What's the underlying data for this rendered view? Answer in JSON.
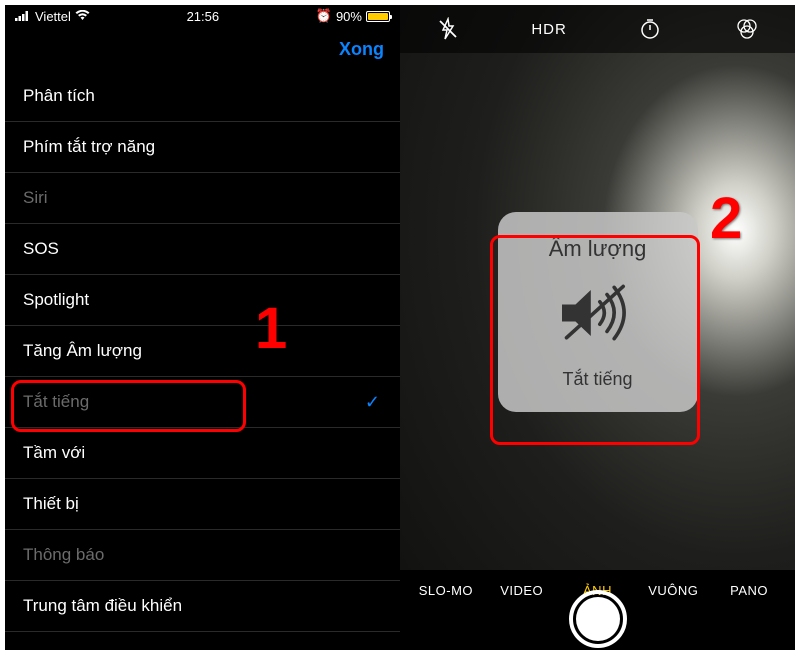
{
  "status": {
    "carrier": "Viettel",
    "time": "21:56",
    "battery_pct": "90%",
    "battery_fill_pct": 90
  },
  "nav": {
    "done": "Xong"
  },
  "settings_items": [
    {
      "label": "Phân tích",
      "dimmed": false,
      "checked": false
    },
    {
      "label": "Phím tắt trợ năng",
      "dimmed": false,
      "checked": false
    },
    {
      "label": "Siri",
      "dimmed": true,
      "checked": false
    },
    {
      "label": "SOS",
      "dimmed": false,
      "checked": false
    },
    {
      "label": "Spotlight",
      "dimmed": false,
      "checked": false
    },
    {
      "label": "Tăng Âm lượng",
      "dimmed": false,
      "checked": false
    },
    {
      "label": "Tắt tiếng",
      "dimmed": true,
      "checked": true
    },
    {
      "label": "Tầm với",
      "dimmed": false,
      "checked": false
    },
    {
      "label": "Thiết bị",
      "dimmed": false,
      "checked": false
    },
    {
      "label": "Thông báo",
      "dimmed": true,
      "checked": false
    },
    {
      "label": "Trung tâm điều khiển",
      "dimmed": false,
      "checked": false
    }
  ],
  "camera": {
    "hdr": "HDR",
    "hud_title": "Âm lượng",
    "hud_subtitle": "Tắt tiếng",
    "modes": [
      "SLO-MO",
      "VIDEO",
      "ẢNH",
      "VUÔNG",
      "PANO"
    ],
    "active_mode_index": 2
  },
  "annotations": {
    "num1": "1",
    "num2": "2"
  }
}
